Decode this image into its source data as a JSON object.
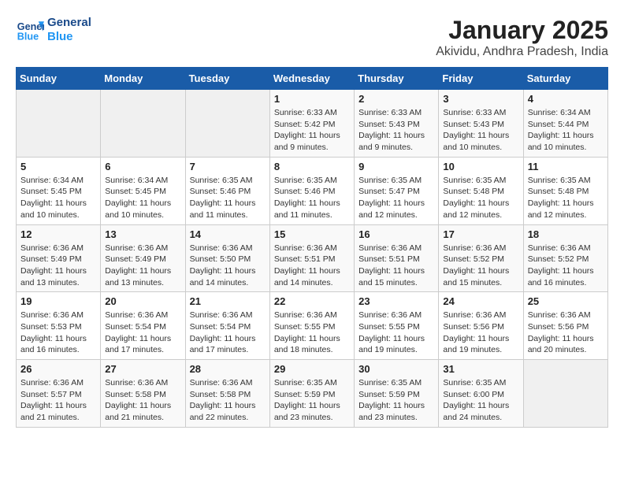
{
  "header": {
    "logo_line1": "General",
    "logo_line2": "Blue",
    "title": "January 2025",
    "subtitle": "Akividu, Andhra Pradesh, India"
  },
  "weekdays": [
    "Sunday",
    "Monday",
    "Tuesday",
    "Wednesday",
    "Thursday",
    "Friday",
    "Saturday"
  ],
  "weeks": [
    [
      {
        "num": "",
        "info": "",
        "empty": true
      },
      {
        "num": "",
        "info": "",
        "empty": true
      },
      {
        "num": "",
        "info": "",
        "empty": true
      },
      {
        "num": "1",
        "info": "Sunrise: 6:33 AM\nSunset: 5:42 PM\nDaylight: 11 hours\nand 9 minutes."
      },
      {
        "num": "2",
        "info": "Sunrise: 6:33 AM\nSunset: 5:43 PM\nDaylight: 11 hours\nand 9 minutes."
      },
      {
        "num": "3",
        "info": "Sunrise: 6:33 AM\nSunset: 5:43 PM\nDaylight: 11 hours\nand 10 minutes."
      },
      {
        "num": "4",
        "info": "Sunrise: 6:34 AM\nSunset: 5:44 PM\nDaylight: 11 hours\nand 10 minutes."
      }
    ],
    [
      {
        "num": "5",
        "info": "Sunrise: 6:34 AM\nSunset: 5:45 PM\nDaylight: 11 hours\nand 10 minutes."
      },
      {
        "num": "6",
        "info": "Sunrise: 6:34 AM\nSunset: 5:45 PM\nDaylight: 11 hours\nand 10 minutes."
      },
      {
        "num": "7",
        "info": "Sunrise: 6:35 AM\nSunset: 5:46 PM\nDaylight: 11 hours\nand 11 minutes."
      },
      {
        "num": "8",
        "info": "Sunrise: 6:35 AM\nSunset: 5:46 PM\nDaylight: 11 hours\nand 11 minutes."
      },
      {
        "num": "9",
        "info": "Sunrise: 6:35 AM\nSunset: 5:47 PM\nDaylight: 11 hours\nand 12 minutes."
      },
      {
        "num": "10",
        "info": "Sunrise: 6:35 AM\nSunset: 5:48 PM\nDaylight: 11 hours\nand 12 minutes."
      },
      {
        "num": "11",
        "info": "Sunrise: 6:35 AM\nSunset: 5:48 PM\nDaylight: 11 hours\nand 12 minutes."
      }
    ],
    [
      {
        "num": "12",
        "info": "Sunrise: 6:36 AM\nSunset: 5:49 PM\nDaylight: 11 hours\nand 13 minutes."
      },
      {
        "num": "13",
        "info": "Sunrise: 6:36 AM\nSunset: 5:49 PM\nDaylight: 11 hours\nand 13 minutes."
      },
      {
        "num": "14",
        "info": "Sunrise: 6:36 AM\nSunset: 5:50 PM\nDaylight: 11 hours\nand 14 minutes."
      },
      {
        "num": "15",
        "info": "Sunrise: 6:36 AM\nSunset: 5:51 PM\nDaylight: 11 hours\nand 14 minutes."
      },
      {
        "num": "16",
        "info": "Sunrise: 6:36 AM\nSunset: 5:51 PM\nDaylight: 11 hours\nand 15 minutes."
      },
      {
        "num": "17",
        "info": "Sunrise: 6:36 AM\nSunset: 5:52 PM\nDaylight: 11 hours\nand 15 minutes."
      },
      {
        "num": "18",
        "info": "Sunrise: 6:36 AM\nSunset: 5:52 PM\nDaylight: 11 hours\nand 16 minutes."
      }
    ],
    [
      {
        "num": "19",
        "info": "Sunrise: 6:36 AM\nSunset: 5:53 PM\nDaylight: 11 hours\nand 16 minutes."
      },
      {
        "num": "20",
        "info": "Sunrise: 6:36 AM\nSunset: 5:54 PM\nDaylight: 11 hours\nand 17 minutes."
      },
      {
        "num": "21",
        "info": "Sunrise: 6:36 AM\nSunset: 5:54 PM\nDaylight: 11 hours\nand 17 minutes."
      },
      {
        "num": "22",
        "info": "Sunrise: 6:36 AM\nSunset: 5:55 PM\nDaylight: 11 hours\nand 18 minutes."
      },
      {
        "num": "23",
        "info": "Sunrise: 6:36 AM\nSunset: 5:55 PM\nDaylight: 11 hours\nand 19 minutes."
      },
      {
        "num": "24",
        "info": "Sunrise: 6:36 AM\nSunset: 5:56 PM\nDaylight: 11 hours\nand 19 minutes."
      },
      {
        "num": "25",
        "info": "Sunrise: 6:36 AM\nSunset: 5:56 PM\nDaylight: 11 hours\nand 20 minutes."
      }
    ],
    [
      {
        "num": "26",
        "info": "Sunrise: 6:36 AM\nSunset: 5:57 PM\nDaylight: 11 hours\nand 21 minutes."
      },
      {
        "num": "27",
        "info": "Sunrise: 6:36 AM\nSunset: 5:58 PM\nDaylight: 11 hours\nand 21 minutes."
      },
      {
        "num": "28",
        "info": "Sunrise: 6:36 AM\nSunset: 5:58 PM\nDaylight: 11 hours\nand 22 minutes."
      },
      {
        "num": "29",
        "info": "Sunrise: 6:35 AM\nSunset: 5:59 PM\nDaylight: 11 hours\nand 23 minutes."
      },
      {
        "num": "30",
        "info": "Sunrise: 6:35 AM\nSunset: 5:59 PM\nDaylight: 11 hours\nand 23 minutes."
      },
      {
        "num": "31",
        "info": "Sunrise: 6:35 AM\nSunset: 6:00 PM\nDaylight: 11 hours\nand 24 minutes."
      },
      {
        "num": "",
        "info": "",
        "empty": true
      }
    ]
  ]
}
